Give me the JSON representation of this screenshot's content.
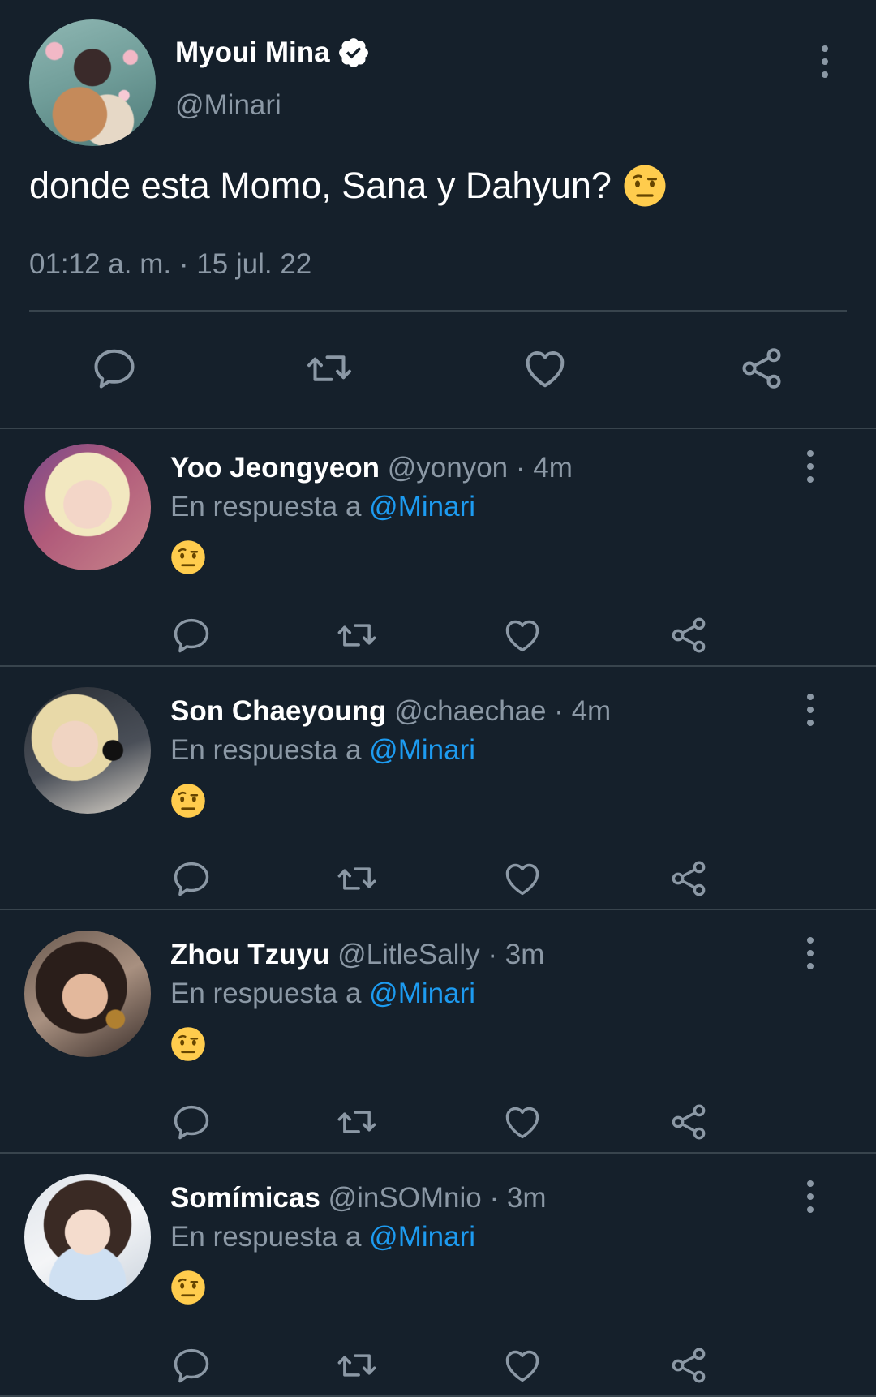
{
  "main_tweet": {
    "author_name": "Myoui Mina",
    "verified": true,
    "handle": "@Minari",
    "text": "donde esta Momo, Sana y Dahyun?",
    "emoji": "face-with-raised-eyebrow",
    "timestamp": "01:12 a. m. · 15 jul. 22",
    "actions": [
      "reply-icon",
      "retweet-icon",
      "like-icon",
      "share-icon"
    ]
  },
  "replies": [
    {
      "name": "Yoo Jeongyeon",
      "meta": "@yonyon · 4m",
      "reply_prefix": "En respuesta a",
      "mention": "@Minari",
      "emoji": "face-with-raised-eyebrow"
    },
    {
      "name": "Son Chaeyoung",
      "meta": "@chaechae · 4m",
      "reply_prefix": "En respuesta a",
      "mention": "@Minari",
      "emoji": "face-with-raised-eyebrow"
    },
    {
      "name": "Zhou Tzuyu",
      "meta": "@LitleSally · 3m",
      "reply_prefix": "En respuesta a",
      "mention": "@Minari",
      "emoji": "face-with-raised-eyebrow"
    },
    {
      "name": "Somímicas",
      "meta": "@inSOMnio · 3m",
      "reply_prefix": "En respuesta a",
      "mention": "@Minari",
      "emoji": "face-with-raised-eyebrow"
    }
  ],
  "colors": {
    "background": "#15202b",
    "text_primary": "#ffffff",
    "text_secondary": "#8b98a5",
    "mention": "#1d9bf0",
    "divider": "#38444d"
  }
}
